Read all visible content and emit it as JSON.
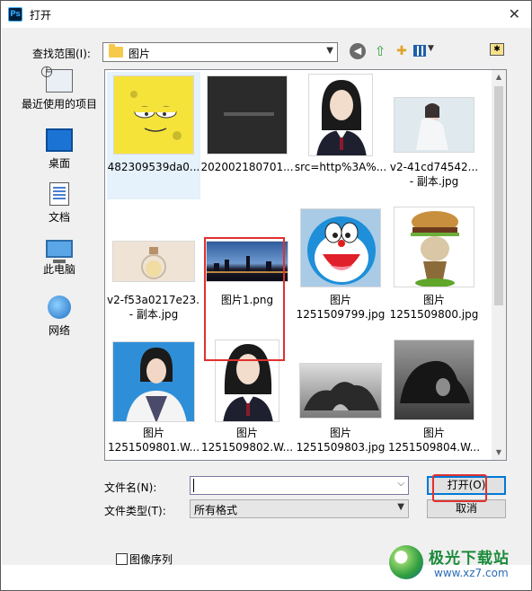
{
  "window": {
    "title": "打开",
    "app_logo": "Ps"
  },
  "toolbar": {
    "look_in_label": "查找范围(I):",
    "look_in_value": "图片",
    "icons": [
      "back-icon",
      "up-folder-icon",
      "new-folder-icon",
      "view-menu-icon",
      "library-icon"
    ]
  },
  "places": [
    {
      "label": "最近使用的项目",
      "icon": "recent-icon"
    },
    {
      "label": "桌面",
      "icon": "desktop-icon"
    },
    {
      "label": "文档",
      "icon": "documents-icon"
    },
    {
      "label": "此电脑",
      "icon": "computer-icon"
    },
    {
      "label": "网络",
      "icon": "network-icon"
    }
  ],
  "files": [
    {
      "line1": "482309539da0...",
      "line2": "",
      "kind": "sponge"
    },
    {
      "line1": "202002180701...",
      "line2": "",
      "kind": "dark"
    },
    {
      "line1": "src=http%3A%...",
      "line2": "",
      "kind": "portrait"
    },
    {
      "line1": "v2-41cd74542...",
      "line2": "- 副本.jpg",
      "kind": "girl"
    },
    {
      "line1": "v2-f53a0217e23...",
      "line2": "- 副本.jpg",
      "kind": "bottle"
    },
    {
      "line1": "图片1.png",
      "line2": "",
      "kind": "city"
    },
    {
      "line1": "图片",
      "line2": "1251509799.jpg",
      "kind": "doraemon"
    },
    {
      "line1": "图片",
      "line2": "1251509800.jpg",
      "kind": "burger"
    },
    {
      "line1": "图片",
      "line2": "1251509801.W...",
      "kind": "student"
    },
    {
      "line1": "图片",
      "line2": "1251509802.W...",
      "kind": "portrait2"
    },
    {
      "line1": "图片",
      "line2": "1251509803.jpg",
      "kind": "rock"
    },
    {
      "line1": "图片",
      "line2": "1251509804.W...",
      "kind": "rock2"
    }
  ],
  "form": {
    "filename_label": "文件名(N):",
    "filename_value": "",
    "filetype_label": "文件类型(T):",
    "filetype_value": "所有格式",
    "open_label": "打开(O)",
    "cancel_label": "取消",
    "sequence_label": "图像序列"
  },
  "watermark": {
    "text": "极光下载站",
    "url": "www.xz7.com"
  }
}
